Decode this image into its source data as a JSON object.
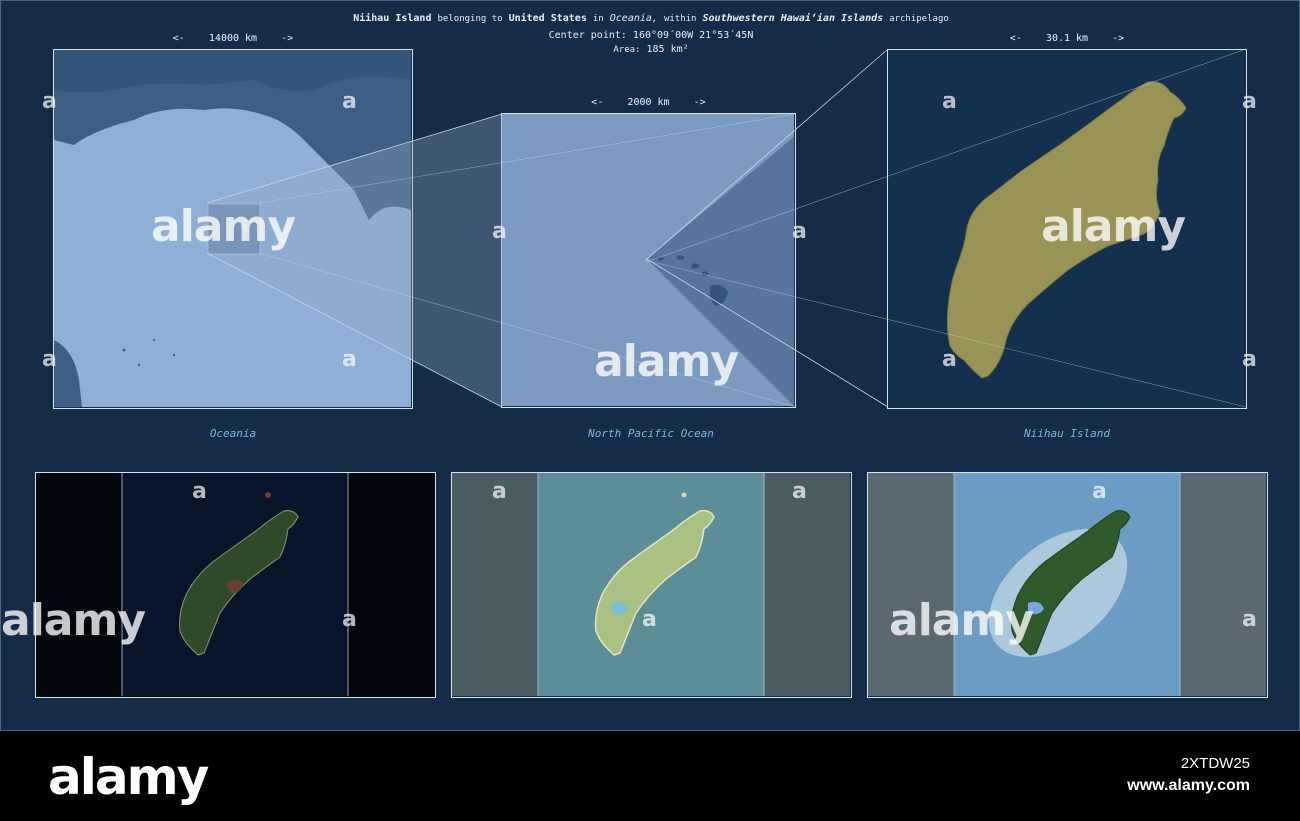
{
  "header": {
    "island_name": "Niihau Island",
    "belonging_to_text": "belonging to",
    "country": "United States",
    "in_text": "in",
    "continent": "Oceania,",
    "within_text": "within",
    "archipelago_name": "Southwestern Hawai‘ian Islands",
    "archipelago_text": "archipelago",
    "center_point": "Center point: 160°09´00W  21°53´45N",
    "area_label": "Area:",
    "area_value": "185 km²"
  },
  "scales": {
    "continent": "<-    14000 km    ->",
    "ocean": "<-    2000 km    ->",
    "island": "<-    30.1 km    ->"
  },
  "captions": {
    "continent": "Oceania",
    "ocean": "North Pacific Ocean",
    "island": "Niihau Island"
  },
  "colors": {
    "background": "#142c48",
    "highlight_fill": "#999355",
    "caption": "#74b8e6"
  },
  "watermark": {
    "word": "alamy",
    "letter": "a"
  },
  "footer": {
    "logo": "alamy",
    "image_id": "2XTDW25",
    "url": "www.alamy.com"
  }
}
